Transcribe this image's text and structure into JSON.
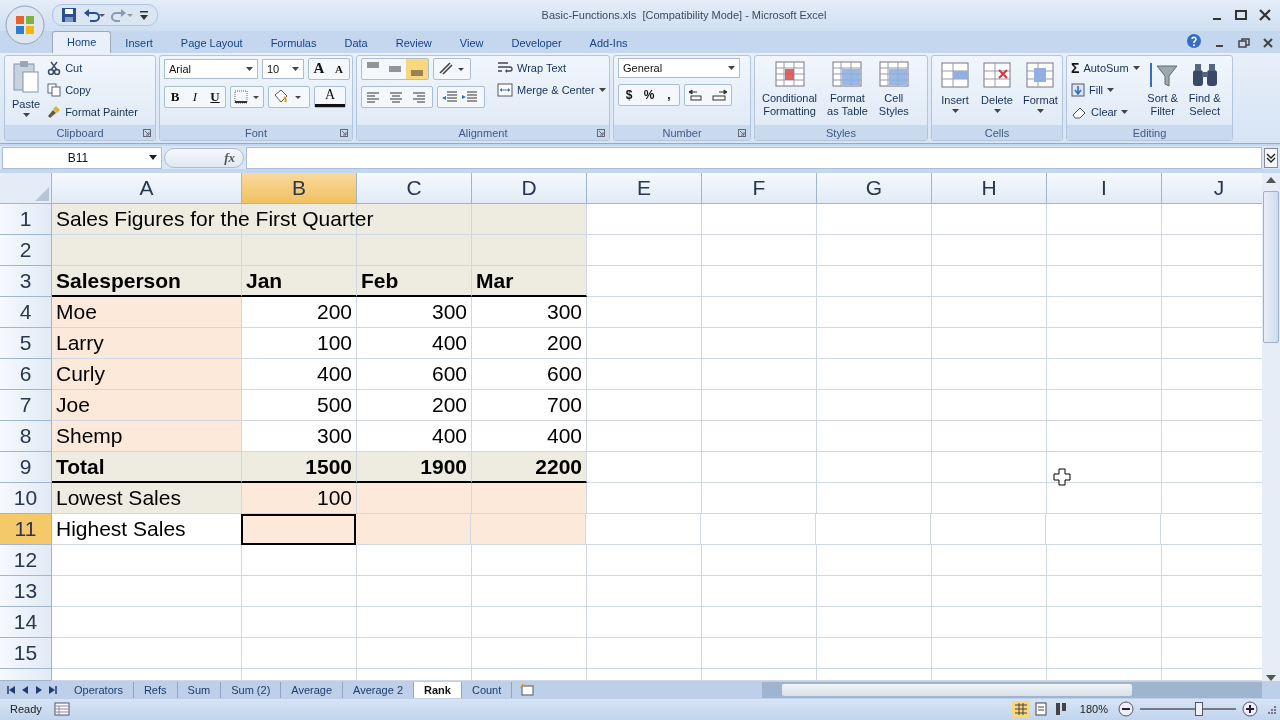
{
  "window": {
    "title": "Basic-Functions.xls  [Compatibility Mode] - Microsoft Excel"
  },
  "tabs": [
    {
      "label": "Home",
      "selected": true
    },
    {
      "label": "Insert",
      "selected": false
    },
    {
      "label": "Page Layout",
      "selected": false
    },
    {
      "label": "Formulas",
      "selected": false
    },
    {
      "label": "Data",
      "selected": false
    },
    {
      "label": "Review",
      "selected": false
    },
    {
      "label": "View",
      "selected": false
    },
    {
      "label": "Developer",
      "selected": false
    },
    {
      "label": "Add-Ins",
      "selected": false
    }
  ],
  "clipboard": {
    "label": "Clipboard",
    "paste": "Paste",
    "cut": "Cut",
    "copy": "Copy",
    "format_painter": "Format Painter"
  },
  "font": {
    "label": "Font",
    "name": "Arial",
    "size": "10",
    "grow": "A",
    "shrink": "A",
    "bold": "B",
    "italic": "I",
    "underline": "U",
    "font_color": "A"
  },
  "alignment": {
    "label": "Alignment",
    "vertical": [
      {
        "selected": false
      },
      {
        "selected": false
      },
      {
        "selected": true
      }
    ],
    "wrap_text": "Wrap Text",
    "merge_center": "Merge & Center"
  },
  "number": {
    "label": "Number",
    "format": "General",
    "buttons": [
      "$",
      "%",
      ","
    ]
  },
  "styles": {
    "label": "Styles",
    "buttons": [
      {
        "lines": [
          "Conditional",
          "Formatting"
        ]
      },
      {
        "lines": [
          "Format",
          "as Table"
        ]
      },
      {
        "lines": [
          "Cell",
          "Styles"
        ]
      }
    ]
  },
  "cells": {
    "label": "Cells",
    "buttons": [
      "Insert",
      "Delete",
      "Format"
    ]
  },
  "editing": {
    "label": "Editing",
    "sigma": "Σ",
    "autosum": "AutoSum",
    "fill": "Fill",
    "clear": "Clear",
    "buttons": [
      {
        "lines": [
          "Sort &",
          "Filter"
        ]
      },
      {
        "lines": [
          "Find &",
          "Select"
        ]
      }
    ]
  },
  "formula_bar": {
    "name_box": "B11",
    "fx": "fx"
  },
  "grid": {
    "columns": [
      {
        "label": "A",
        "selected": false
      },
      {
        "label": "B",
        "selected": true
      },
      {
        "label": "C",
        "selected": false
      },
      {
        "label": "D",
        "selected": false
      },
      {
        "label": "E",
        "selected": false
      },
      {
        "label": "F",
        "selected": false
      },
      {
        "label": "G",
        "selected": false
      },
      {
        "label": "H",
        "selected": false
      },
      {
        "label": "I",
        "selected": false
      },
      {
        "label": "J",
        "selected": false
      }
    ],
    "rows": [
      {
        "label": "1",
        "selected": false,
        "rule_below": false,
        "cells": [
          {
            "text": "Sales Figures for the First Quarter",
            "color": "#eeece1",
            "bold": false,
            "right_aligned": false
          },
          {
            "color": "#eeece1"
          },
          {
            "color": "#eeece1"
          },
          {
            "color": "#eeece1"
          }
        ]
      },
      {
        "label": "2",
        "selected": false,
        "rule_below": false,
        "cells": [
          {
            "color": "#eeece1"
          },
          {
            "color": "#eeece1"
          },
          {
            "color": "#eeece1"
          },
          {
            "color": "#eeece1"
          }
        ]
      },
      {
        "label": "3",
        "selected": false,
        "rule_below": true,
        "cells": [
          {
            "text": "Salesperson",
            "color": "#eeece1",
            "bold": true,
            "right_aligned": false
          },
          {
            "text": "Jan",
            "color": "#eeece1",
            "bold": true,
            "right_aligned": false
          },
          {
            "text": "Feb",
            "color": "#eeece1",
            "bold": true,
            "right_aligned": false
          },
          {
            "text": "Mar",
            "color": "#eeece1",
            "bold": true,
            "right_aligned": false
          }
        ]
      },
      {
        "label": "4",
        "selected": false,
        "rule_below": false,
        "cells": [
          {
            "text": "Moe",
            "color": "#fde9d9",
            "bold": false,
            "right_aligned": false
          },
          {
            "text": "200",
            "color": "#ffffff",
            "bold": false,
            "right_aligned": true
          },
          {
            "text": "300",
            "color": "#ffffff",
            "bold": false,
            "right_aligned": true
          },
          {
            "text": "300",
            "color": "#ffffff",
            "bold": false,
            "right_aligned": true
          }
        ]
      },
      {
        "label": "5",
        "selected": false,
        "rule_below": false,
        "cells": [
          {
            "text": "Larry",
            "color": "#fde9d9",
            "bold": false,
            "right_aligned": false
          },
          {
            "text": "100",
            "color": "#ffffff",
            "bold": false,
            "right_aligned": true
          },
          {
            "text": "400",
            "color": "#ffffff",
            "bold": false,
            "right_aligned": true
          },
          {
            "text": "200",
            "color": "#ffffff",
            "bold": false,
            "right_aligned": true
          }
        ]
      },
      {
        "label": "6",
        "selected": false,
        "rule_below": false,
        "cells": [
          {
            "text": "Curly",
            "color": "#fde9d9",
            "bold": false,
            "right_aligned": false
          },
          {
            "text": "400",
            "color": "#ffffff",
            "bold": false,
            "right_aligned": true
          },
          {
            "text": "600",
            "color": "#ffffff",
            "bold": false,
            "right_aligned": true
          },
          {
            "text": "600",
            "color": "#ffffff",
            "bold": false,
            "right_aligned": true
          }
        ]
      },
      {
        "label": "7",
        "selected": false,
        "rule_below": false,
        "cells": [
          {
            "text": "Joe",
            "color": "#fde9d9",
            "bold": false,
            "right_aligned": false
          },
          {
            "text": "500",
            "color": "#ffffff",
            "bold": false,
            "right_aligned": true
          },
          {
            "text": "200",
            "color": "#ffffff",
            "bold": false,
            "right_aligned": true
          },
          {
            "text": "700",
            "color": "#ffffff",
            "bold": false,
            "right_aligned": true
          }
        ]
      },
      {
        "label": "8",
        "selected": false,
        "rule_below": false,
        "cells": [
          {
            "text": "Shemp",
            "color": "#fde9d9",
            "bold": false,
            "right_aligned": false
          },
          {
            "text": "300",
            "color": "#ffffff",
            "bold": false,
            "right_aligned": true
          },
          {
            "text": "400",
            "color": "#ffffff",
            "bold": false,
            "right_aligned": true
          },
          {
            "text": "400",
            "color": "#ffffff",
            "bold": false,
            "right_aligned": true
          }
        ]
      },
      {
        "label": "9",
        "selected": false,
        "rule_below": true,
        "cells": [
          {
            "text": "Total",
            "color": "#eeece1",
            "bold": true,
            "right_aligned": false
          },
          {
            "text": "1500",
            "color": "#eeece1",
            "bold": true,
            "right_aligned": true
          },
          {
            "text": "1900",
            "color": "#eeece1",
            "bold": true,
            "right_aligned": true
          },
          {
            "text": "2200",
            "color": "#eeece1",
            "bold": true,
            "right_aligned": true
          }
        ]
      },
      {
        "label": "10",
        "selected": false,
        "rule_below": false,
        "cells": [
          {
            "text": "Lowest Sales",
            "color": "#eeece1",
            "bold": false,
            "right_aligned": false
          },
          {
            "text": "100",
            "color": "#fde9d9",
            "bold": false,
            "right_aligned": true
          },
          {
            "color": "#fde9d9"
          },
          {
            "color": "#fde9d9"
          }
        ]
      },
      {
        "label": "11",
        "selected": true,
        "rule_below": false,
        "cells": [
          {
            "text": "Highest Sales",
            "color": "#ffffff",
            "bold": false,
            "right_aligned": false
          },
          {
            "color": "#fde9d9",
            "active": true
          },
          {
            "color": "#fde9d9"
          },
          {
            "color": "#fde9d9"
          }
        ]
      },
      {
        "label": "12",
        "selected": false,
        "rule_below": false,
        "cells": []
      },
      {
        "label": "13",
        "selected": false,
        "rule_below": false,
        "cells": []
      },
      {
        "label": "14",
        "selected": false,
        "rule_below": false,
        "cells": []
      },
      {
        "label": "15",
        "selected": false,
        "rule_below": false,
        "cells": []
      }
    ]
  },
  "sheet_tabs": [
    {
      "label": "Operators",
      "selected": false
    },
    {
      "label": "Refs",
      "selected": false
    },
    {
      "label": "Sum",
      "selected": false
    },
    {
      "label": "Sum (2)",
      "selected": false
    },
    {
      "label": "Average",
      "selected": false
    },
    {
      "label": "Average 2",
      "selected": false
    },
    {
      "label": "Rank",
      "selected": true
    },
    {
      "label": "Count",
      "selected": false
    }
  ],
  "status_bar": {
    "status": "Ready",
    "views": [
      {
        "selected": true
      },
      {
        "selected": false
      },
      {
        "selected": false
      }
    ],
    "zoom": "180%",
    "zoom_level": {
      "level": 0.61
    }
  }
}
